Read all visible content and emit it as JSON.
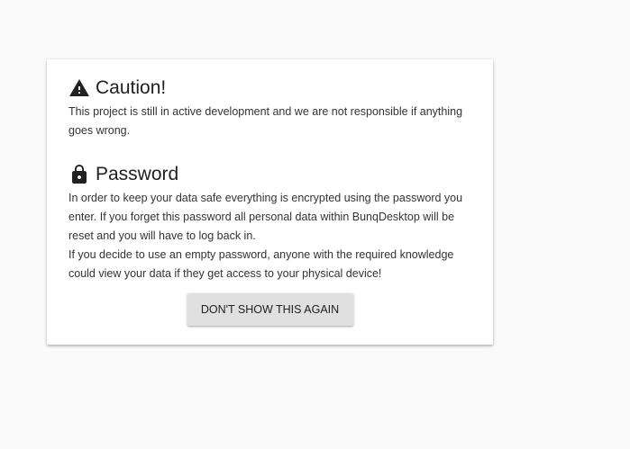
{
  "caution": {
    "icon": "warning-icon",
    "title": "Caution!",
    "text": "This project is still in active development and we are not responsible if anything goes wrong."
  },
  "password": {
    "icon": "lock-icon",
    "title": "Password",
    "text1": "In order to keep your data safe everything is encrypted using the password you enter. If you forget this password all personal data within BunqDesktop will be reset and you will have to log back in.",
    "text2": "If you decide to use an empty password, anyone with the required knowledge could view your data if they get access to your physical device!"
  },
  "actions": {
    "dismiss_label": "DON'T SHOW THIS AGAIN"
  },
  "colors": {
    "background": "#fafafa",
    "card": "#ffffff",
    "button": "#e0e0e0",
    "text": "#212121"
  }
}
